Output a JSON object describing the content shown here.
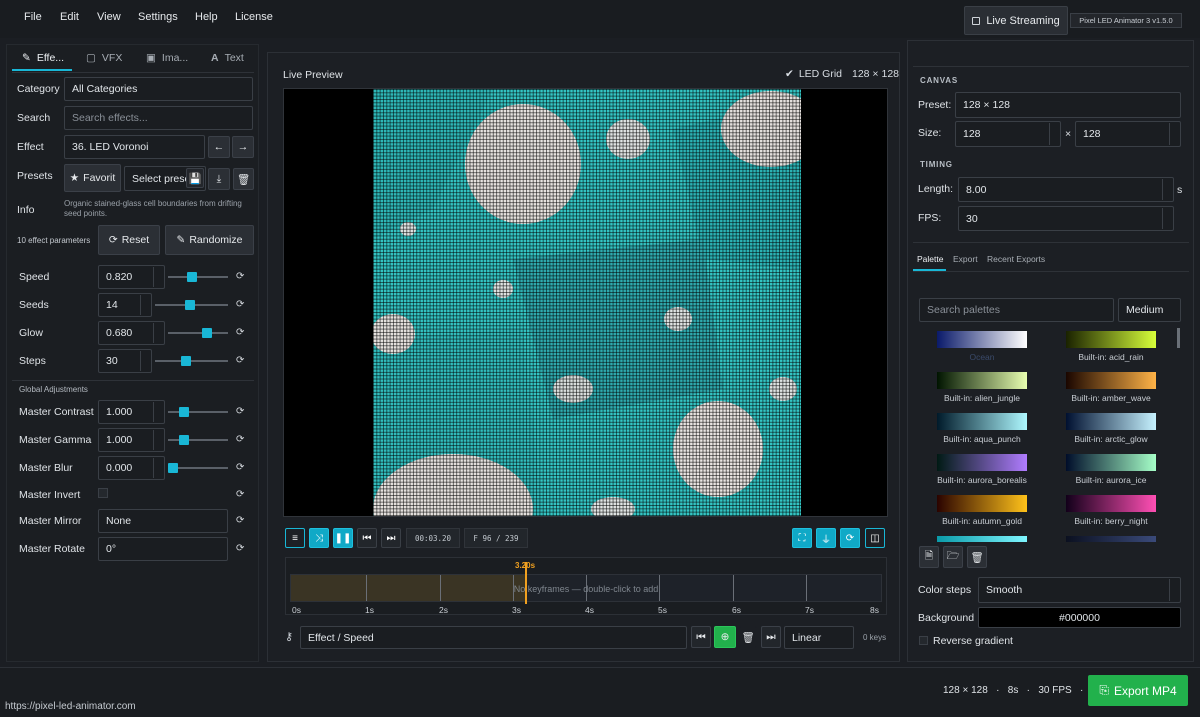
{
  "menu": [
    "File",
    "Edit",
    "View",
    "Settings",
    "Help",
    "License"
  ],
  "live_streaming": "Live Streaming",
  "app_badge": "Pixel LED Animator 3  v1.5.0",
  "left": {
    "tabs": [
      "Effe...",
      "VFX",
      "Ima...",
      "Text"
    ],
    "category_label": "Category",
    "category_value": "All Categories",
    "search_label": "Search",
    "search_placeholder": "Search effects...",
    "effect_label": "Effect",
    "effect_value": "36. LED Voronoi",
    "presets_label": "Presets",
    "favorite_label": "Favorit",
    "select_preset": "Select prese",
    "info_label": "Info",
    "info_text": "Organic stained-glass cell boundaries from drifting seed points.",
    "param_count": "10 effect parameters",
    "reset_label": "Reset",
    "randomize_label": "Randomize",
    "params": [
      {
        "label": "Speed",
        "value": "0.820",
        "level": 0.38
      },
      {
        "label": "Seeds",
        "value": "14",
        "level": 0.47
      },
      {
        "label": "Glow",
        "value": "0.680",
        "level": 0.68
      },
      {
        "label": "Steps",
        "value": "30",
        "level": 0.42
      }
    ],
    "global_title": "Global Adjustments",
    "globals": [
      {
        "label": "Master Contrast",
        "value": "1.000",
        "level": 0.22
      },
      {
        "label": "Master Gamma",
        "value": "1.000",
        "level": 0.22
      },
      {
        "label": "Master Blur",
        "value": "0.000",
        "level": 0.0
      }
    ],
    "invert_label": "Master Invert",
    "mirror_label": "Master Mirror",
    "mirror_value": "None",
    "rotate_label": "Master Rotate",
    "rotate_value": "0°"
  },
  "center": {
    "title": "Live Preview",
    "led_grid_label": "LED Grid",
    "grid_size": "128 × 128",
    "time": "00:03.20",
    "frame": "F 96 / 239",
    "playhead_label": "3.20s",
    "playhead_fraction": 0.4,
    "timeline_hint": "No keyframes — double-click to add",
    "ticks": [
      "0s",
      "1s",
      "2s",
      "3s",
      "4s",
      "5s",
      "6s",
      "7s",
      "8s"
    ],
    "track_label": "Effect / Speed",
    "interp": "Linear",
    "keys": "0 keys"
  },
  "right": {
    "canvas_title": "CANVAS",
    "preset_label": "Preset:",
    "preset_value": "128 × 128",
    "size_label": "Size:",
    "width": "128",
    "times": "×",
    "height": "128",
    "timing_title": "TIMING",
    "length_label": "Length:",
    "length_value": "8.00",
    "length_unit": "s",
    "fps_label": "FPS:",
    "fps_value": "30",
    "tabs": [
      "Palette",
      "Export",
      "Recent Exports"
    ],
    "palette_search": "Search palettes",
    "palette_size": "Medium",
    "palettes": [
      {
        "name": "Ocean",
        "c1": "#0a1a6a",
        "c2": "#ffffff"
      },
      {
        "name": "Built-in: acid_rain",
        "c1": "#1a2200",
        "c2": "#d7ff3a"
      },
      {
        "name": "Built-in: alien_jungle",
        "c1": "#001400",
        "c2": "#e8ffb0"
      },
      {
        "name": "Built-in: amber_wave",
        "c1": "#1a0600",
        "c2": "#ffb347"
      },
      {
        "name": "Built-in: aqua_punch",
        "c1": "#001a2a",
        "c2": "#aef8ff"
      },
      {
        "name": "Built-in: arctic_glow",
        "c1": "#001030",
        "c2": "#c6f2ff"
      },
      {
        "name": "Built-in: aurora_borealis",
        "c1": "#001a14",
        "c2": "#b07cff"
      },
      {
        "name": "Built-in: aurora_ice",
        "c1": "#000d2a",
        "c2": "#a6ffc8"
      },
      {
        "name": "Built-in: autumn_gold",
        "c1": "#2a0300",
        "c2": "#ffc21a"
      },
      {
        "name": "Built-in: berry_night",
        "c1": "#12001a",
        "c2": "#ff4fb4"
      }
    ],
    "color_steps_label": "Color steps",
    "color_steps_value": "Smooth",
    "background_label": "Background",
    "background_value": "#000000",
    "reverse_label": "Reverse gradient"
  },
  "status": {
    "url": "https://pixel-led-animator.com",
    "summary": "128 × 128   ·   8s   ·   30 FPS   ·   MP4",
    "export_label": "Export MP4"
  },
  "colors": {
    "accent": "#19b7d6",
    "export_green": "#22b14c",
    "playhead": "#f0a020",
    "led_cyan": "#35c7c6",
    "led_white": "#e9e4e1"
  }
}
